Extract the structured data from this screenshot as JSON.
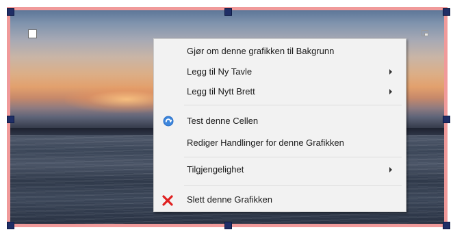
{
  "graphic": {
    "image": "sunset-over-sea",
    "border_color": "#f09a9a",
    "handle_color": "#1f2e66"
  },
  "context_menu": {
    "items": [
      {
        "label": "Gjør om denne grafikken til Bakgrunn",
        "submenu": false
      },
      {
        "label": "Legg til Ny Tavle",
        "submenu": true
      },
      {
        "label": "Legg til Nytt Brett",
        "submenu": true
      },
      {
        "label": "Test denne Cellen",
        "submenu": false,
        "icon": "test-icon"
      },
      {
        "label": "Rediger Handlinger for denne Grafikken",
        "submenu": false
      },
      {
        "label": "Tilgjengelighet",
        "submenu": true
      },
      {
        "label": "Slett denne Grafikken",
        "submenu": false,
        "icon": "delete-x-icon"
      }
    ]
  },
  "colors": {
    "delete_icon": "#e02020",
    "test_icon": "#2f73c9"
  }
}
